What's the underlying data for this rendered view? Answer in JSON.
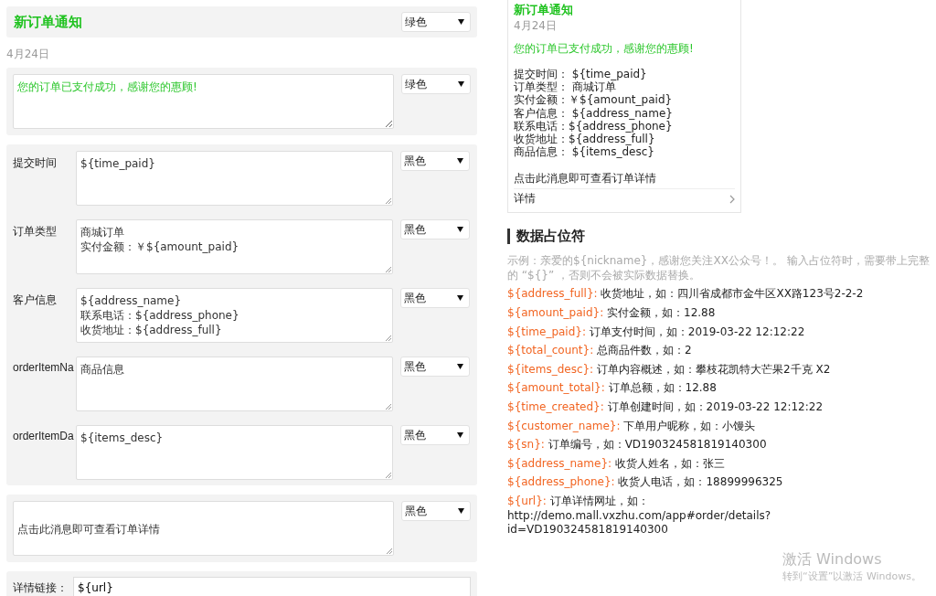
{
  "editor": {
    "title": {
      "text": "新订单通知",
      "color_option": "绿色",
      "color": "#1fc21f"
    },
    "date": "4月24日",
    "first": {
      "value": "您的订单已支付成功，感谢您的惠顾!",
      "color_option": "绿色",
      "color": "#2dc72d"
    },
    "fields": [
      {
        "label": "提交时间",
        "lines": [
          "${time_paid}"
        ],
        "color_option": "黑色"
      },
      {
        "label": "订单类型",
        "lines": [
          "商城订单",
          "实付金额：￥${amount_paid}"
        ],
        "color_option": "黑色"
      },
      {
        "label": "客户信息",
        "lines": [
          "${address_name}",
          "联系电话：${address_phone}",
          "收货地址：${address_full}"
        ],
        "color_option": "黑色"
      },
      {
        "label": "orderItemNa",
        "lines": [
          "商品信息"
        ],
        "color_option": "黑色"
      },
      {
        "label": "orderItemDa",
        "lines": [
          "${items_desc}"
        ],
        "color_option": "黑色"
      }
    ],
    "remark": {
      "value": "点击此消息即可查看订单详情",
      "color_option": "黑色"
    },
    "link": {
      "label": "详情链接：",
      "value": "${url}"
    }
  },
  "preview": {
    "title": "新订单通知",
    "date": "4月24日",
    "first": "您的订单已支付成功，感谢您的惠顾!",
    "lines": [
      "提交时间：  ${time_paid}",
      "订单类型：  商城订单",
      "实付金额：￥${amount_paid}",
      "客户信息：  ${address_name}",
      "联系电话：${address_phone}",
      "收货地址：${address_full}",
      "商品信息：  ${items_desc}"
    ],
    "remark": "点击此消息即可查看订单详情",
    "detail_link": "详情"
  },
  "placeholders": {
    "title": "数据占位符",
    "hint": "示例：亲爱的${nickname}，感谢您关注XX公众号！。 输入占位符时，需要带上完整的 “${}” ，否则不会被实际数据替换。",
    "items": [
      {
        "key": "${address_full}:",
        "desc": "收货地址，如：四川省成都市金牛区XX路123号2-2-2"
      },
      {
        "key": "${amount_paid}:",
        "desc": "实付金额，如：12.88"
      },
      {
        "key": "${time_paid}:",
        "desc": "订单支付时间，如：2019-03-22 12:12:22"
      },
      {
        "key": "${total_count}:",
        "desc": "总商品件数，如：2"
      },
      {
        "key": "${items_desc}:",
        "desc": "订单内容概述，如：攀枝花凯特大芒果2千克 X2"
      },
      {
        "key": "${amount_total}:",
        "desc": "订单总额，如：12.88"
      },
      {
        "key": "${time_created}:",
        "desc": "订单创建时间，如：2019-03-22 12:12:22"
      },
      {
        "key": "${customer_name}:",
        "desc": "下单用户昵称，如：小馒头"
      },
      {
        "key": "${sn}:",
        "desc": "订单编号，如：VD190324581819140300"
      },
      {
        "key": "${address_name}:",
        "desc": "收货人姓名，如：张三"
      },
      {
        "key": "${address_phone}:",
        "desc": "收货人电话，如：18899996325"
      },
      {
        "key": "${url}:",
        "desc": "订单详情网址，如：http://demo.mall.vxzhu.com/app#order/details?id=VD190324581819140300"
      }
    ]
  },
  "os_notice": {
    "title": "激活 Windows",
    "text": "转到“设置”以激活 Windows。"
  }
}
